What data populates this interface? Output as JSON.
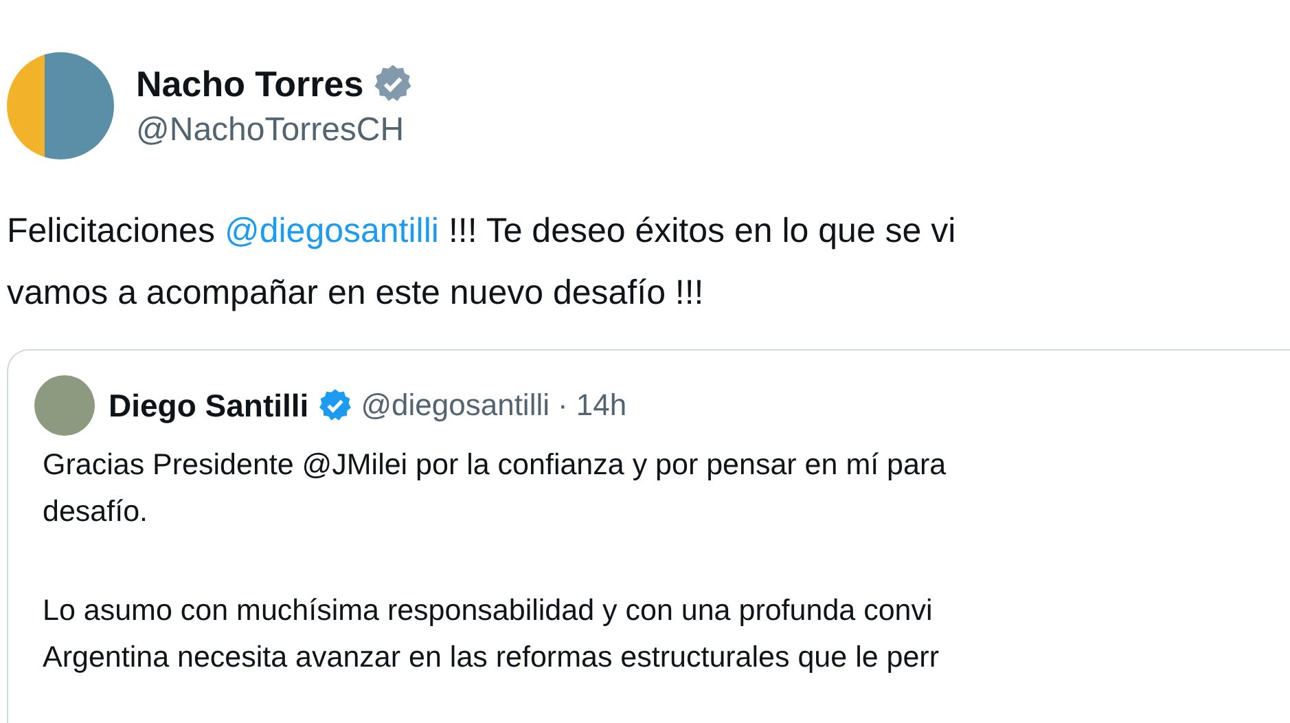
{
  "tweet": {
    "author": {
      "name": "Nacho Torres",
      "badge": {
        "kind": "government"
      },
      "handle": "@NachoTorresCH"
    },
    "text": [
      [
        {
          "kind": "plain",
          "text": "Felicitaciones"
        },
        {
          "kind": "mention",
          "text": "@diegosantilli"
        },
        {
          "kind": "plain",
          "text": "!!! Te deseo éxitos en lo que se vi"
        }
      ],
      [
        {
          "kind": "plain",
          "text": "vamos a acompañar en este nuevo desafío !!!"
        }
      ]
    ],
    "quoted": {
      "author": {
        "name": "Diego Santilli",
        "badge": {
          "kind": "blue"
        },
        "handle": "@diegosantilli",
        "time": "· 14h"
      },
      "paragraphs": [
        [
          "Gracias Presidente @JMilei por la confianza y por pensar en mí para",
          "desafío."
        ],
        [
          "Lo asumo con muchísima responsabilidad y con una profunda convi",
          "Argentina necesita avanzar en las reformas estructurales que le perr"
        ]
      ]
    }
  }
}
